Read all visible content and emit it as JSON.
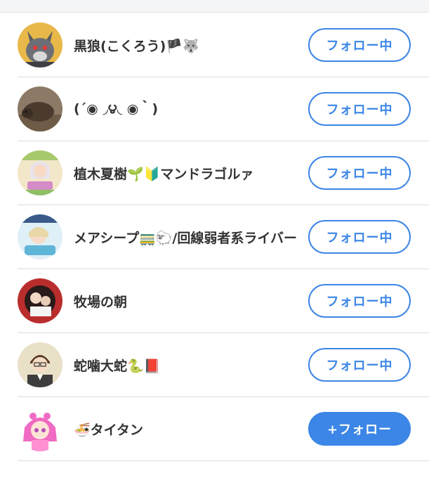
{
  "users": [
    {
      "name": "黒狼(こくろう)🏴🐺",
      "button": "フォロー中",
      "following": true,
      "avatar_icon": "gray-wolf-character-avatar"
    },
    {
      "name": "(´◉ ◞౪◟ ◉｀)",
      "button": "フォロー中",
      "following": true,
      "avatar_icon": "wild-boar-photo-avatar"
    },
    {
      "name": "植木夏樹🌱🔰マンドラゴルァ",
      "button": "フォロー中",
      "following": true,
      "avatar_icon": "anime-girl-avatar"
    },
    {
      "name": "メアシープ🚃🐑/回線弱者系ライバー",
      "button": "フォロー中",
      "following": true,
      "avatar_icon": "anime-girl-sheep-avatar"
    },
    {
      "name": "牧場の朝",
      "button": "フォロー中",
      "following": true,
      "avatar_icon": "anime-characters-avatar"
    },
    {
      "name": "蛇噛大蛇🐍📕",
      "button": "フォロー中",
      "following": true,
      "avatar_icon": "glasses-boy-avatar"
    },
    {
      "name": "🍜タイタン",
      "button": "+フォロー",
      "following": false,
      "avatar_icon": "pink-hair-girl-avatar"
    }
  ],
  "colors": {
    "accent": "#3b86e6",
    "text": "#333333",
    "divider": "#dcdcdc"
  }
}
